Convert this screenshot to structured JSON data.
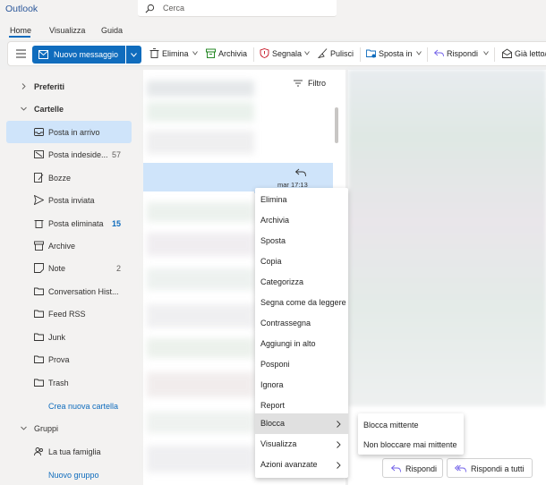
{
  "app": {
    "title": "Outlook"
  },
  "search": {
    "placeholder": "Cerca"
  },
  "menu_tabs": [
    {
      "label": "Home",
      "active": true
    },
    {
      "label": "Visualizza",
      "active": false
    },
    {
      "label": "Guida",
      "active": false
    }
  ],
  "ribbon": {
    "new_message": "Nuovo messaggio",
    "delete": "Elimina",
    "archive": "Archivia",
    "report": "Segnala",
    "sweep": "Pulisci",
    "move_to": "Sposta in",
    "reply": "Rispondi",
    "read_unread": "Già letto/"
  },
  "sidebar": {
    "favorites": "Preferiti",
    "folders": "Cartelle",
    "items": [
      {
        "label": "Posta in arrivo",
        "icon": "inbox-icon",
        "count": "",
        "selected": true
      },
      {
        "label": "Posta indeside...",
        "icon": "junk-icon",
        "count": "57",
        "selected": false
      },
      {
        "label": "Bozze",
        "icon": "draft-icon",
        "count": "",
        "selected": false
      },
      {
        "label": "Posta inviata",
        "icon": "send-icon",
        "count": "",
        "selected": false
      },
      {
        "label": "Posta eliminata",
        "icon": "trash-icon",
        "count": "15",
        "selected": false
      },
      {
        "label": "Archive",
        "icon": "archive-icon",
        "count": "",
        "selected": false
      },
      {
        "label": "Note",
        "icon": "note-icon",
        "count": "2",
        "selected": false
      },
      {
        "label": "Conversation Hist...",
        "icon": "folder-icon",
        "count": "",
        "selected": false
      },
      {
        "label": "Feed RSS",
        "icon": "folder-icon",
        "count": "",
        "selected": false
      },
      {
        "label": "Junk",
        "icon": "folder-icon",
        "count": "",
        "selected": false
      },
      {
        "label": "Prova",
        "icon": "folder-icon",
        "count": "",
        "selected": false
      },
      {
        "label": "Trash",
        "icon": "folder-icon",
        "count": "",
        "selected": false
      }
    ],
    "new_folder": "Crea nuova cartella",
    "groups": "Gruppi",
    "group_items": [
      {
        "label": "La tua famiglia",
        "icon": "people-icon"
      }
    ],
    "new_group": "Nuovo gruppo"
  },
  "message_list": {
    "filter": "Filtro",
    "selected_time": "mar 17:13"
  },
  "context_menu": {
    "items": [
      {
        "label": "Elimina",
        "submenu": false
      },
      {
        "label": "Archivia",
        "submenu": false
      },
      {
        "label": "Sposta",
        "submenu": false
      },
      {
        "label": "Copia",
        "submenu": false
      },
      {
        "label": "Categorizza",
        "submenu": false
      },
      {
        "label": "Segna come da leggere",
        "submenu": false
      },
      {
        "label": "Contrassegna",
        "submenu": false
      },
      {
        "label": "Aggiungi in alto",
        "submenu": false
      },
      {
        "label": "Posponi",
        "submenu": false
      },
      {
        "label": "Ignora",
        "submenu": false
      },
      {
        "label": "Report",
        "submenu": false
      },
      {
        "label": "Blocca",
        "submenu": true,
        "hover": true
      },
      {
        "label": "Visualizza",
        "submenu": true
      },
      {
        "label": "Azioni avanzate",
        "submenu": true
      }
    ]
  },
  "submenu": {
    "items": [
      {
        "label": "Blocca mittente"
      },
      {
        "label": "Non bloccare mai mittente"
      }
    ]
  },
  "reading_pane": {
    "reply": "Rispondi",
    "reply_all": "Rispondi a tutti"
  },
  "colors": {
    "accent": "#0f6cbd",
    "selected_bg": "#cfe4fa",
    "hover_bg": "#e0e0e0"
  }
}
